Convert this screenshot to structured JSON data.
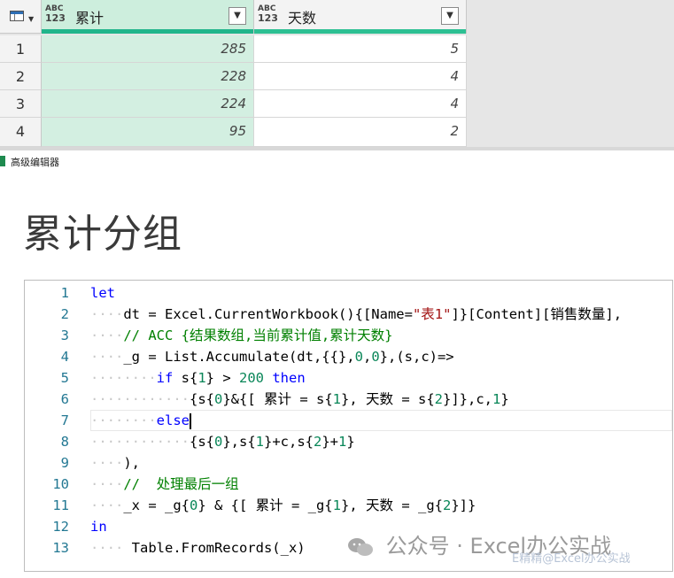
{
  "grid": {
    "columns": [
      {
        "type_top": "ABC",
        "type_bottom": "123",
        "name": "累计",
        "dropdown": "▼"
      },
      {
        "type_top": "ABC",
        "type_bottom": "123",
        "name": "天数",
        "dropdown": "▼"
      }
    ],
    "rows": [
      {
        "num": "1",
        "c1": "285",
        "c2": "5"
      },
      {
        "num": "2",
        "c1": "228",
        "c2": "4"
      },
      {
        "num": "3",
        "c1": "224",
        "c2": "4"
      },
      {
        "num": "4",
        "c1": "95",
        "c2": "2"
      }
    ],
    "corner_dropdown": "▼"
  },
  "window": {
    "title": "高级编辑器"
  },
  "page_title": "累计分组",
  "editor": {
    "line_numbers": [
      "1",
      "2",
      "3",
      "4",
      "5",
      "6",
      "7",
      "8",
      "9",
      "10",
      "11",
      "12",
      "13"
    ]
  },
  "watermark": {
    "main": "公众号 · Excel办公实战",
    "sub": "E精精@Excel办公实战"
  },
  "colors": {
    "accent_green": "#21b58b",
    "keyword": "#0000ff",
    "comment": "#008000",
    "string": "#a31515",
    "number": "#098658"
  }
}
